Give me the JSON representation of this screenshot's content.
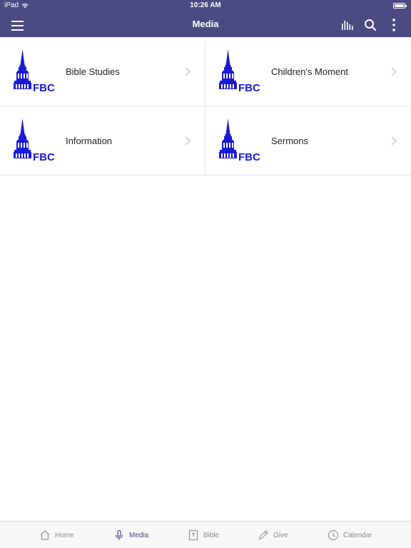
{
  "status": {
    "device": "iPad",
    "time": "10:26 AM"
  },
  "nav": {
    "title": "Media"
  },
  "colors": {
    "header": "#4a4b82",
    "logo_blue": "#1a1ad6",
    "active_tab": "#4a4b82"
  },
  "items": [
    {
      "label": "Bible Studies",
      "logo_text": "FBC"
    },
    {
      "label": "Children's Moment",
      "logo_text": "FBC"
    },
    {
      "label": "Information",
      "logo_text": "FBC"
    },
    {
      "label": "Sermons",
      "logo_text": "FBC"
    }
  ],
  "tabs": [
    {
      "label": "Home",
      "icon": "home-icon",
      "active": false
    },
    {
      "label": "Media",
      "icon": "microphone-icon",
      "active": true
    },
    {
      "label": "Bible",
      "icon": "bible-icon",
      "active": false
    },
    {
      "label": "Give",
      "icon": "pencil-icon",
      "active": false
    },
    {
      "label": "Calendar",
      "icon": "clock-icon",
      "active": false
    }
  ]
}
